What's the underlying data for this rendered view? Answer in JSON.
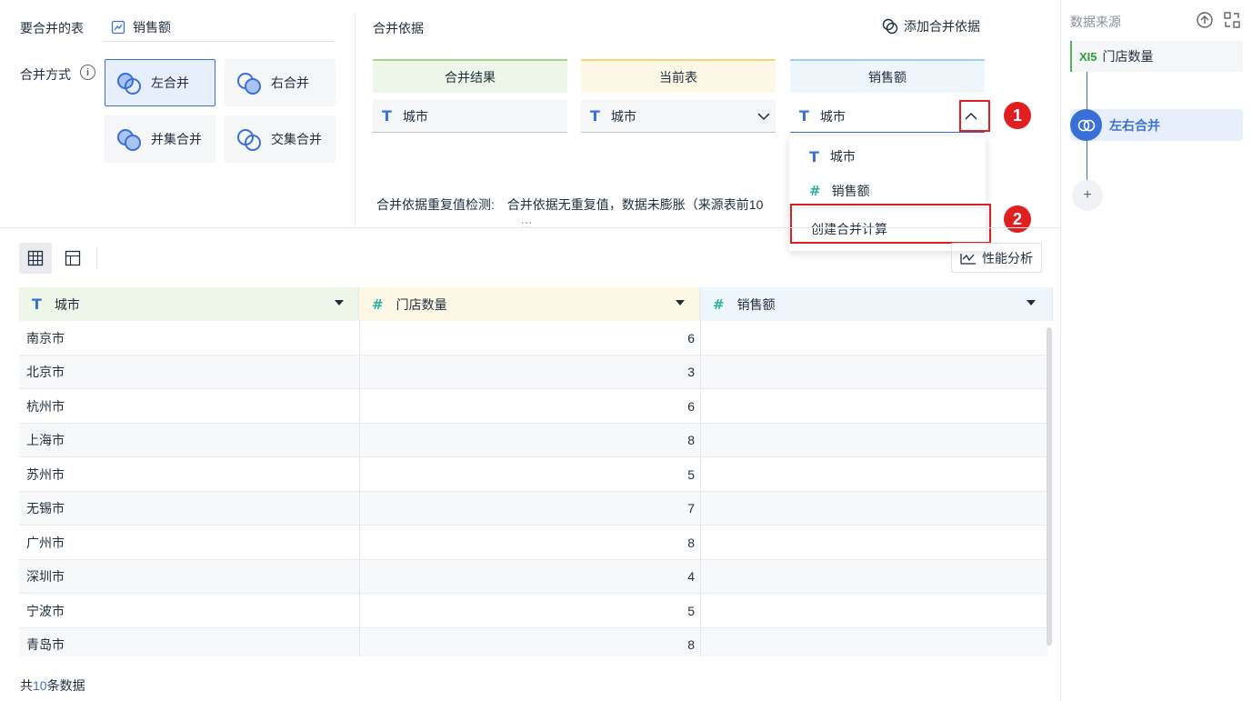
{
  "merge_table": {
    "label": "要合并的表",
    "table_name": "销售额"
  },
  "merge_mode": {
    "label": "合并方式",
    "info_icon": "info-icon",
    "options": [
      {
        "label": "左合并",
        "active": true
      },
      {
        "label": "右合并",
        "active": false
      },
      {
        "label": "并集合并",
        "active": false
      },
      {
        "label": "交集合并",
        "active": false
      }
    ]
  },
  "merge_basis": {
    "label": "合并依据",
    "add_label": "添加合并依据",
    "columns": [
      {
        "header": "合并结果",
        "field": "城市",
        "color": "#eef6ea",
        "line": "#a8d58e"
      },
      {
        "header": "当前表",
        "field": "城市",
        "color": "#fdf8e6",
        "line": "#f1d77a"
      },
      {
        "header": "销售额",
        "field": "城市",
        "color": "#eef6fb",
        "line": "#9fd0ec"
      }
    ],
    "check_label": "合并依据重复值检测:",
    "check_text": "合并依据无重复值，数据未膨胀（来源表前10"
  },
  "dropdown": {
    "items": [
      {
        "label": "城市",
        "type": "text"
      },
      {
        "label": "销售额",
        "type": "number"
      }
    ],
    "create_label": "创建合并计算"
  },
  "annotations": {
    "badge1": "1",
    "badge2": "2"
  },
  "toolbar": {
    "perf_label": "性能分析",
    "drag_handle": ":::"
  },
  "table": {
    "headers": [
      {
        "label": "城市",
        "type": "text"
      },
      {
        "label": "门店数量",
        "type": "number"
      },
      {
        "label": "销售额",
        "type": "number"
      }
    ],
    "rows": [
      [
        "南京市",
        "6",
        ""
      ],
      [
        "北京市",
        "3",
        ""
      ],
      [
        "杭州市",
        "6",
        ""
      ],
      [
        "上海市",
        "8",
        ""
      ],
      [
        "苏州市",
        "5",
        ""
      ],
      [
        "无锡市",
        "7",
        ""
      ],
      [
        "广州市",
        "8",
        ""
      ],
      [
        "深圳市",
        "4",
        ""
      ],
      [
        "宁波市",
        "5",
        ""
      ],
      [
        "青岛市",
        "8",
        ""
      ]
    ],
    "footer_prefix": "共",
    "footer_count": "10",
    "footer_suffix": "条数据"
  },
  "right_panel": {
    "title": "数据来源",
    "source_icon": "XI5",
    "source_name": "门店数量",
    "step_label": "左右合并",
    "add_symbol": "+"
  }
}
